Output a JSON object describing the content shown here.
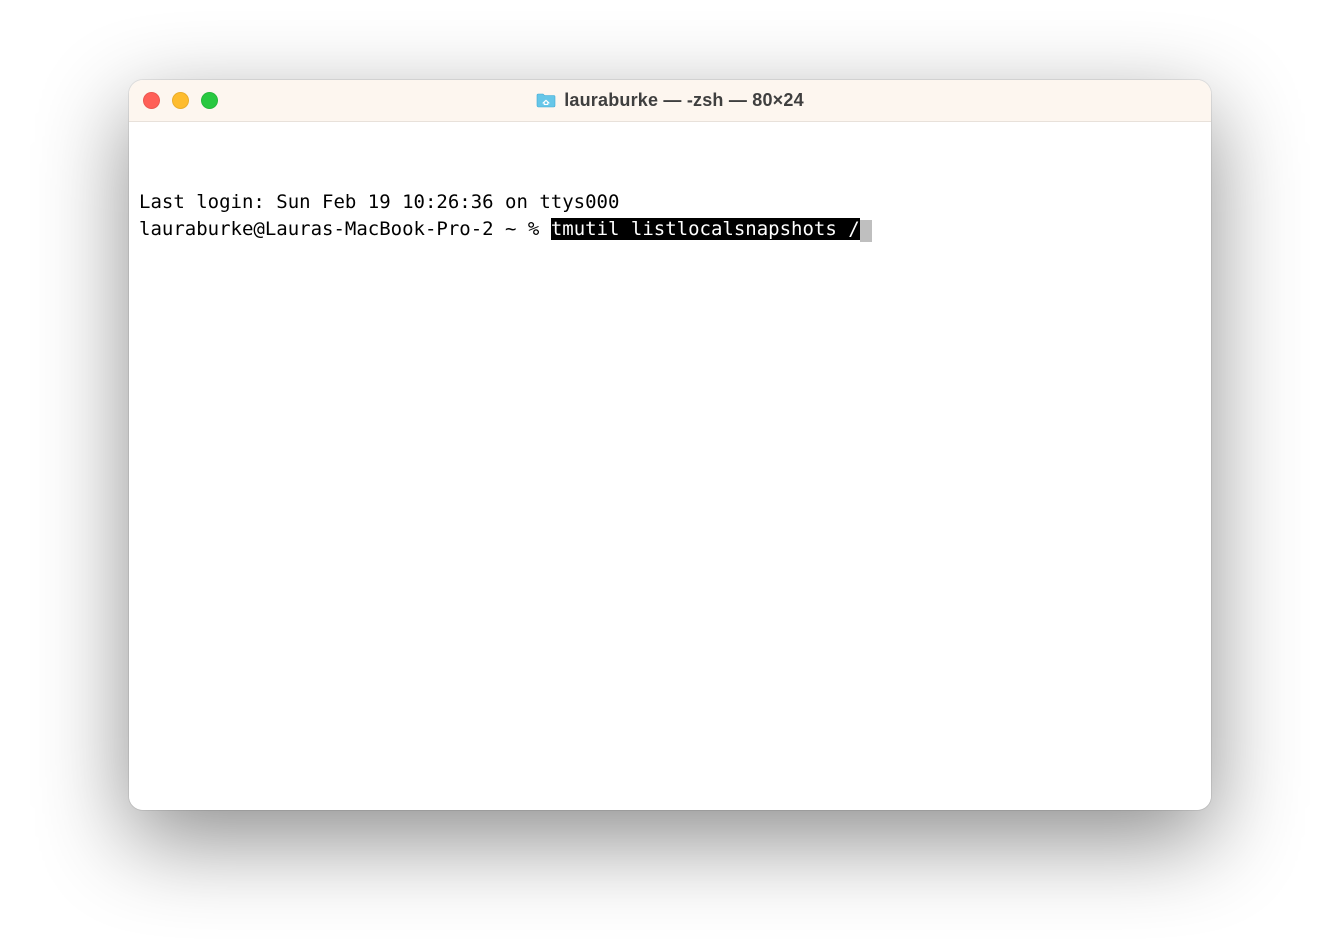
{
  "window": {
    "title": "lauraburke — -zsh — 80×24"
  },
  "terminal": {
    "last_login": "Last login: Sun Feb 19 10:26:36 on ttys000",
    "prompt": "lauraburke@Lauras-MacBook-Pro-2 ~ % ",
    "command": "tmutil listlocalsnapshots /"
  }
}
